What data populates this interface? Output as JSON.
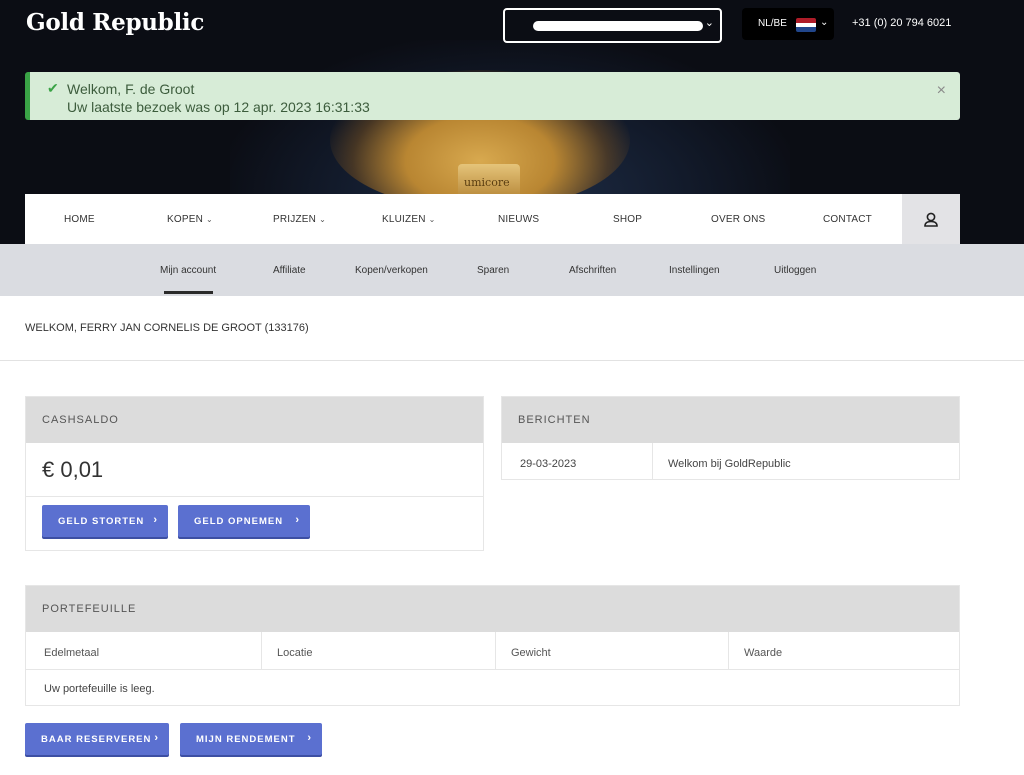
{
  "header": {
    "logo": "Gold Republic",
    "language_code": "NL/BE",
    "phone": "+31 (0) 20 794 6021",
    "hero_bar_brand": "umicore"
  },
  "alert": {
    "line1": "Welkom, F. de Groot",
    "line2": "Uw laatste bezoek was op 12 apr. 2023 16:31:33",
    "close": "×"
  },
  "main_nav": {
    "items": [
      {
        "label": "HOME",
        "dropdown": false
      },
      {
        "label": "KOPEN",
        "dropdown": true
      },
      {
        "label": "PRIJZEN",
        "dropdown": true
      },
      {
        "label": "KLUIZEN",
        "dropdown": true
      },
      {
        "label": "NIEUWS",
        "dropdown": false
      },
      {
        "label": "SHOP",
        "dropdown": false
      },
      {
        "label": "OVER ONS",
        "dropdown": false
      },
      {
        "label": "CONTACT",
        "dropdown": false
      }
    ]
  },
  "sub_nav": {
    "active": "Mijn account",
    "items": [
      "Mijn account",
      "Affiliate",
      "Kopen/verkopen",
      "Sparen",
      "Afschriften",
      "Instellingen",
      "Uitloggen"
    ]
  },
  "welcome": "WELKOM, FERRY JAN CORNELIS DE GROOT (133176)",
  "cashsaldo": {
    "title": "CASHSALDO",
    "balance": "€ 0,01",
    "deposit_button": "GELD STORTEN",
    "withdraw_button": "GELD OPNEMEN"
  },
  "berichten": {
    "title": "BERICHTEN",
    "rows": [
      {
        "date": "29-03-2023",
        "text": "Welkom bij GoldRepublic"
      }
    ]
  },
  "portefeuille": {
    "title": "PORTEFEUILLE",
    "columns": [
      "Edelmetaal",
      "Locatie",
      "Gewicht",
      "Waarde"
    ],
    "empty_text": "Uw portefeuille is leeg."
  },
  "actions": {
    "reserve_button": "BAAR RESERVEREN",
    "yield_button": "MIJN RENDEMENT"
  },
  "colors": {
    "button": "#5b70d0",
    "alert_bg": "#d7ecd7",
    "alert_accent": "#3aa346",
    "subnav_bg": "#dadce1",
    "card_header": "#dcdcdc"
  },
  "icons": [
    "check-icon",
    "close-icon",
    "chevron-down-icon",
    "user-icon",
    "chevron-right-icon",
    "flag-nl-icon"
  ]
}
